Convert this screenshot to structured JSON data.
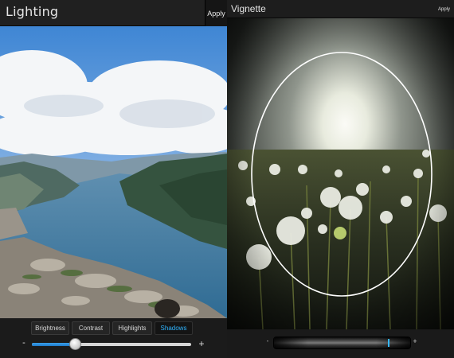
{
  "lighting": {
    "title": "Lighting",
    "apply_label": "Apply",
    "tabs": [
      {
        "label": "Brightness",
        "selected": false
      },
      {
        "label": "Contrast",
        "selected": false
      },
      {
        "label": "Highlights",
        "selected": false
      },
      {
        "label": "Shadows",
        "selected": true
      }
    ],
    "slider": {
      "minus_label": "-",
      "plus_label": "+",
      "value": 0.27
    },
    "photo": "fjord-landscape-photo"
  },
  "vignette": {
    "title": "Vignette",
    "apply_label": "Apply",
    "adjust": {
      "minus_label": "-",
      "plus_label": "+",
      "value": 0.83
    },
    "photo": "dandelion-field-sunset-photo"
  },
  "colors": {
    "accent": "#2fb4ff",
    "toolbar_bg": "#1c1c1c"
  }
}
